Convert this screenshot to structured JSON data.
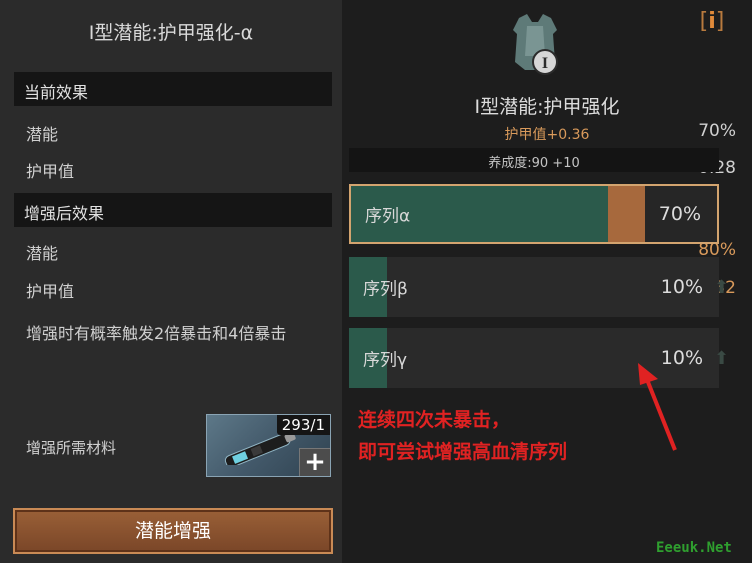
{
  "left": {
    "title": "Ⅰ型潜能:护甲强化-α",
    "current": {
      "header": "当前效果",
      "rows": [
        {
          "label": "潜能",
          "value": "70%"
        },
        {
          "label": "护甲值",
          "value": "0.28"
        }
      ]
    },
    "after": {
      "header": "增强后效果",
      "rows": [
        {
          "label": "潜能",
          "value": "80%"
        },
        {
          "label": "护甲值",
          "value": "0.32"
        }
      ]
    },
    "note": "增强时有概率触发2倍暴击和4倍暴击",
    "materials": {
      "label": "增强所需材料",
      "count": "293/1",
      "plus": "+"
    },
    "button_label": "潜能增强"
  },
  "right": {
    "info_icon": "info-icon",
    "emblem_icon": "armor-icon",
    "title": "Ⅰ型潜能:护甲强化",
    "subtitle": "护甲值+0.36",
    "cultivation": "养成度:90 +10",
    "sequences": [
      {
        "name": "序列α",
        "value": "70%",
        "fill": 0.7,
        "selected": true
      },
      {
        "name": "序列β",
        "value": "10%",
        "fill": 0.1,
        "selected": false
      },
      {
        "name": "序列γ",
        "value": "10%",
        "fill": 0.1,
        "selected": false
      }
    ]
  },
  "annotation": {
    "line1": "连续四次未暴击，",
    "line2": "即可尝试增强高血清序列"
  },
  "watermark": "Eeeuk.Net",
  "colors": {
    "accent": "#d99a5b",
    "fill_green": "#2b5a4b",
    "fill_orange": "#a7693d",
    "annotation": "#e02222"
  }
}
